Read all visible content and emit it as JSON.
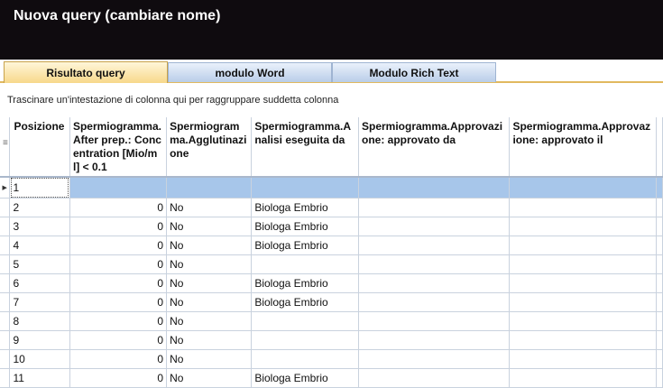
{
  "window": {
    "title": "Nuova query (cambiare nome)"
  },
  "tabs": [
    {
      "label": "Risultato query",
      "active": true
    },
    {
      "label": "modulo Word",
      "active": false
    },
    {
      "label": "Modulo Rich Text",
      "active": false
    }
  ],
  "group_panel": {
    "hint": "Trascinare un'intestazione di colonna qui per raggruppare suddetta colonna"
  },
  "grid": {
    "columns": [
      "Posizione",
      "Spermiogramma. After prep.: Concentration [Mio/ml] < 0.1",
      "Spermiogramma.Agglutinazione",
      "Spermiogramma.Analisi eseguita da",
      "Spermiogramma.Approvazione: approvato da",
      "Spermiogramma.Approvazione: approvato il"
    ],
    "rows": [
      {
        "pos": "1",
        "conc": "",
        "aggl": "",
        "analisi": "",
        "appr_da": "",
        "appr_il": "",
        "selected": true
      },
      {
        "pos": "2",
        "conc": "0",
        "aggl": "No",
        "analisi": "Biologa Embrio",
        "appr_da": "",
        "appr_il": ""
      },
      {
        "pos": "3",
        "conc": "0",
        "aggl": "No",
        "analisi": "Biologa Embrio",
        "appr_da": "",
        "appr_il": ""
      },
      {
        "pos": "4",
        "conc": "0",
        "aggl": "No",
        "analisi": "Biologa Embrio",
        "appr_da": "",
        "appr_il": ""
      },
      {
        "pos": "5",
        "conc": "0",
        "aggl": "No",
        "analisi": "",
        "appr_da": "",
        "appr_il": ""
      },
      {
        "pos": "6",
        "conc": "0",
        "aggl": "No",
        "analisi": "Biologa Embrio",
        "appr_da": "",
        "appr_il": ""
      },
      {
        "pos": "7",
        "conc": "0",
        "aggl": "No",
        "analisi": "Biologa Embrio",
        "appr_da": "",
        "appr_il": ""
      },
      {
        "pos": "8",
        "conc": "0",
        "aggl": "No",
        "analisi": "",
        "appr_da": "",
        "appr_il": ""
      },
      {
        "pos": "9",
        "conc": "0",
        "aggl": "No",
        "analisi": "",
        "appr_da": "",
        "appr_il": ""
      },
      {
        "pos": "10",
        "conc": "0",
        "aggl": "No",
        "analisi": "",
        "appr_da": "",
        "appr_il": ""
      },
      {
        "pos": "11",
        "conc": "0",
        "aggl": "No",
        "analisi": "Biologa Embrio",
        "appr_da": "",
        "appr_il": ""
      }
    ]
  },
  "icons": {
    "column_chooser": "column-chooser-icon",
    "row_indicator": "current-row-indicator-icon"
  },
  "colors": {
    "titlebar": "#0f0b0f",
    "tab_active": "#f7d88a",
    "tab_inactive": "#b9cde8",
    "selected_row": "#a7c6ea"
  }
}
